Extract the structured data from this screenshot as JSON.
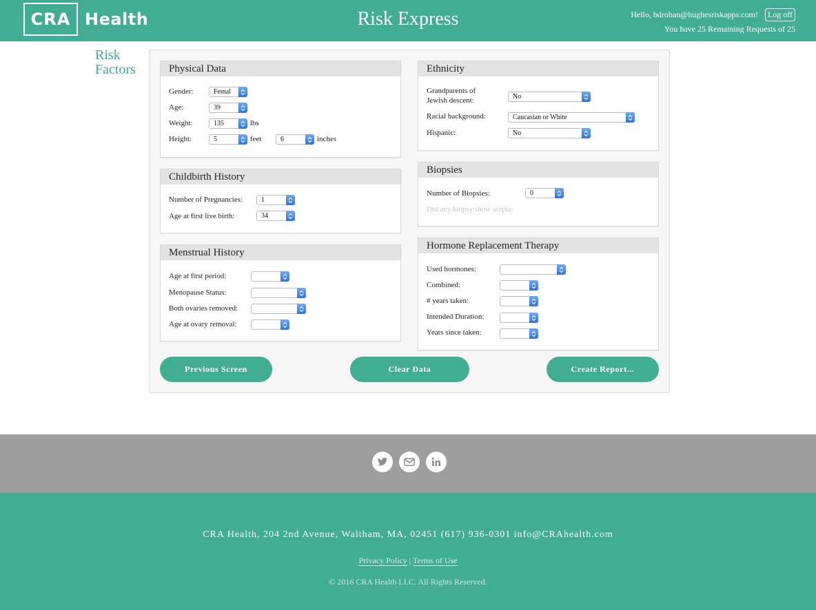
{
  "header": {
    "logo_left": "CRA",
    "logo_right": "Health",
    "app_title": "Risk Express",
    "greeting": "Hello, bdrohan@hughesriskapps.com!",
    "logoff_label": "Log off",
    "remaining_text": "You have 25 Remaining Requests of 25"
  },
  "sidebar": {
    "title_line1": "Risk",
    "title_line2": "Factors"
  },
  "physical_data": {
    "title": "Physical Data",
    "gender_label": "Gender:",
    "gender_value": "Femal",
    "age_label": "Age:",
    "age_value": "39",
    "weight_label": "Weight:",
    "weight_value": "135",
    "weight_unit": "lbs",
    "height_label": "Height:",
    "height_feet_value": "5",
    "feet_unit": "feet",
    "height_inches_value": "6",
    "inches_unit": "inches"
  },
  "ethnicity": {
    "title": "Ethnicity",
    "jewish_label_1": "Grandparents of",
    "jewish_label_2": "Jewish descent:",
    "jewish_value": "No",
    "racial_label": "Racial background:",
    "racial_value": "Caucasian or White",
    "hispanic_label": "Hispanic:",
    "hispanic_value": "No"
  },
  "childbirth": {
    "title": "Childbirth History",
    "pregnancies_label": "Number of Pregnancies:",
    "pregnancies_value": "1",
    "first_birth_label": "Age at first live birth:",
    "first_birth_value": "34"
  },
  "biopsies": {
    "title": "Biopsies",
    "number_label": "Number of Biopsies:",
    "number_value": "0",
    "atypia_label": "Did any biopsy show atypia:"
  },
  "menstrual": {
    "title": "Menstrual History",
    "first_period_label": "Age at first period:",
    "first_period_value": "",
    "menopause_label": "Menopause Status:",
    "menopause_value": "",
    "ovaries_label": "Both ovaries removed:",
    "ovaries_value": "",
    "ovary_age_label": "Age at ovary removal:",
    "ovary_age_value": ""
  },
  "hrt": {
    "title": "Hormone Replacement Therapy",
    "used_label": "Used hormones:",
    "used_value": "",
    "combined_label": "Combined:",
    "combined_value": "",
    "years_label": "# years taken:",
    "years_value": "",
    "intended_label": "Intended Duration:",
    "intended_value": "",
    "since_label": "Years since taken:",
    "since_value": ""
  },
  "buttons": {
    "previous": "Previous Screen",
    "clear": "Clear Data",
    "create": "Create Report..."
  },
  "social": {
    "icons": [
      "twitter-icon",
      "mail-icon",
      "linkedin-icon"
    ]
  },
  "footer": {
    "address": "CRA Health, 204 2nd Avenue, Waltham, MA, 02451 (617) 936-0301 info@CRAhealth.com",
    "privacy": "Privacy Policy",
    "separator": "|",
    "terms": "Terms of Use",
    "copyright": "© 2016 CRA Health LLC. All Rights Reserved."
  },
  "colors": {
    "brand_green": "#41ad93",
    "footer_grey": "#9e9e9e",
    "select_arrow": "#2a72e6"
  }
}
